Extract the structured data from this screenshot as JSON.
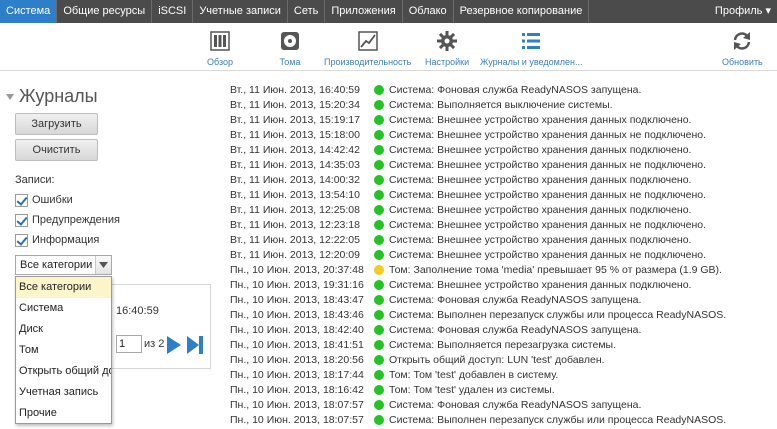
{
  "nav": {
    "tabs": [
      {
        "label": "Система",
        "active": true
      },
      {
        "label": "Общие ресурсы",
        "active": false
      },
      {
        "label": "iSCSI",
        "active": false
      },
      {
        "label": "Учетные записи",
        "active": false
      },
      {
        "label": "Сеть",
        "active": false
      },
      {
        "label": "Приложения",
        "active": false
      },
      {
        "label": "Облако",
        "active": false
      },
      {
        "label": "Резервное копирование",
        "active": false
      }
    ],
    "profile": "Профиль ▾"
  },
  "toolbar": {
    "overview": "Обзор",
    "volumes": "Тома",
    "performance": "Производительность",
    "settings": "Настройки",
    "logs": "Журналы и уведомлен...",
    "refresh": "Обновить"
  },
  "left": {
    "title": "Журналы",
    "download_btn": "Загрузить",
    "clear_btn": "Очистить",
    "records_label": "Записи:",
    "filters": [
      {
        "label": "Ошибки",
        "checked": true
      },
      {
        "label": "Предупреждения",
        "checked": true
      },
      {
        "label": "Информация",
        "checked": true
      }
    ],
    "category_selected": "Все категории",
    "category_options": [
      "Все категории",
      "Система",
      "Диск",
      "Том",
      "Открыть общий до",
      "Учетная запись",
      "Прочие"
    ],
    "bg_time": "16:40:59",
    "page_value": "1",
    "page_of": "из 2"
  },
  "colors": {
    "info": "#22c422",
    "warning": "#f2cc1f",
    "accent": "#2c7fc8"
  },
  "logs": [
    {
      "ts": "Вт., 11 Июн. 2013, 16:40:59",
      "level": "info",
      "msg": "Система: Фоновая служба ReadyNASOS запущена."
    },
    {
      "ts": "Вт., 11 Июн. 2013, 15:20:34",
      "level": "info",
      "msg": "Система: Выполняется выключение системы."
    },
    {
      "ts": "Вт., 11 Июн. 2013, 15:19:17",
      "level": "info",
      "msg": "Система: Внешнее устройство хранения данных подключено."
    },
    {
      "ts": "Вт., 11 Июн. 2013, 15:18:00",
      "level": "info",
      "msg": "Система: Внешнее устройство хранения данных не подключено."
    },
    {
      "ts": "Вт., 11 Июн. 2013, 14:42:42",
      "level": "info",
      "msg": "Система: Внешнее устройство хранения данных подключено."
    },
    {
      "ts": "Вт., 11 Июн. 2013, 14:35:03",
      "level": "info",
      "msg": "Система: Внешнее устройство хранения данных не подключено."
    },
    {
      "ts": "Вт., 11 Июн. 2013, 14:00:32",
      "level": "info",
      "msg": "Система: Внешнее устройство хранения данных подключено."
    },
    {
      "ts": "Вт., 11 Июн. 2013, 13:54:10",
      "level": "info",
      "msg": "Система: Внешнее устройство хранения данных не подключено."
    },
    {
      "ts": "Вт., 11 Июн. 2013, 12:25:08",
      "level": "info",
      "msg": "Система: Внешнее устройство хранения данных подключено."
    },
    {
      "ts": "Вт., 11 Июн. 2013, 12:23:18",
      "level": "info",
      "msg": "Система: Внешнее устройство хранения данных не подключено."
    },
    {
      "ts": "Вт., 11 Июн. 2013, 12:22:05",
      "level": "info",
      "msg": "Система: Внешнее устройство хранения данных подключено."
    },
    {
      "ts": "Вт., 11 Июн. 2013, 12:20:09",
      "level": "info",
      "msg": "Система: Внешнее устройство хранения данных не подключено."
    },
    {
      "ts": "Пн., 10 Июн. 2013, 20:37:48",
      "level": "warning",
      "msg": "Том: Заполнение тома 'media' превышает 95 % от размера (1.9 GB)."
    },
    {
      "ts": "Пн., 10 Июн. 2013, 19:31:16",
      "level": "info",
      "msg": "Система: Внешнее устройство хранения данных подключено."
    },
    {
      "ts": "Пн., 10 Июн. 2013, 18:43:47",
      "level": "info",
      "msg": "Система: Фоновая служба ReadyNASOS запущена."
    },
    {
      "ts": "Пн., 10 Июн. 2013, 18:43:46",
      "level": "info",
      "msg": "Система: Выполнен перезапуск службы или процесса ReadyNASOS."
    },
    {
      "ts": "Пн., 10 Июн. 2013, 18:42:40",
      "level": "info",
      "msg": "Система: Фоновая служба ReadyNASOS запущена."
    },
    {
      "ts": "Пн., 10 Июн. 2013, 18:41:51",
      "level": "info",
      "msg": "Система: Выполняется перезагрузка системы."
    },
    {
      "ts": "Пн., 10 Июн. 2013, 18:20:56",
      "level": "info",
      "msg": "Открыть общий доступ: LUN 'test' добавлен."
    },
    {
      "ts": "Пн., 10 Июн. 2013, 18:17:44",
      "level": "info",
      "msg": "Том: Том 'test' добавлен в систему."
    },
    {
      "ts": "Пн., 10 Июн. 2013, 18:16:42",
      "level": "info",
      "msg": "Том: Том 'test' удален из системы."
    },
    {
      "ts": "Пн., 10 Июн. 2013, 18:07:57",
      "level": "info",
      "msg": "Система: Фоновая служба ReadyNASOS запущена."
    },
    {
      "ts": "Пн., 10 Июн. 2013, 18:07:57",
      "level": "info",
      "msg": "Система: Выполнен перезапуск службы или процесса ReadyNASOS."
    }
  ]
}
